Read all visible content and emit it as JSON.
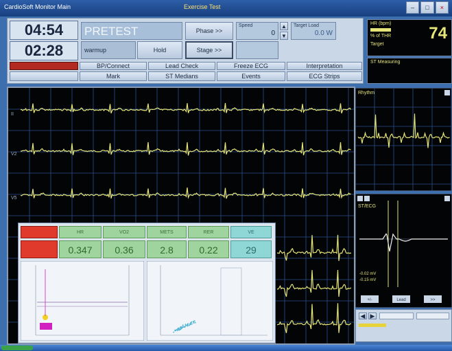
{
  "window": {
    "title": "Exercise Test",
    "app_title": "CardioSoft Monitor Main"
  },
  "timers": {
    "t1": "04:54",
    "t2": "02:28"
  },
  "phase": {
    "name": "PRETEST",
    "stage": "warmup"
  },
  "buttons": {
    "phase": "Phase >>",
    "stage": "Stage >>",
    "hold": "Hold",
    "bp_connect": "BP/Connect",
    "lead_check": "Lead Check",
    "freeze_ecg": "Freeze ECG",
    "interpretation": "Interpretation",
    "mark": "Mark",
    "st_medians": "ST Medians",
    "events": "Events",
    "ecg_strips": "ECG Strips"
  },
  "fields": {
    "speed_label": "Speed",
    "speed_value": "0",
    "target_label": "Target Load",
    "target_value": "0.0 W"
  },
  "hr": {
    "label": "HR (bpm)",
    "value": "74",
    "sub1": "% of THR",
    "sub2": "Target"
  },
  "right_top": {
    "label": "ST Measuring"
  },
  "leads": [
    "II",
    "V2",
    "V5"
  ],
  "rhythm": {
    "label": "Rhythm"
  },
  "median": {
    "label": "ST/ECG",
    "val1": "-0.02 mV",
    "val2": "-0.15 mV",
    "b1": "+/-",
    "b2": "Lead",
    "b3": ">>"
  },
  "stats": {
    "headers": [
      "HR",
      "VO2",
      "METS",
      "RER",
      "VE"
    ],
    "values": [
      "0.347",
      "0.36",
      "2.8",
      "0.22",
      "29"
    ]
  },
  "colors": {
    "ecg": "#e6e57a",
    "grid": "#2a4f8e",
    "green": "#9fd49e",
    "red": "#e03a2c",
    "cyan": "#8fd7d6"
  }
}
